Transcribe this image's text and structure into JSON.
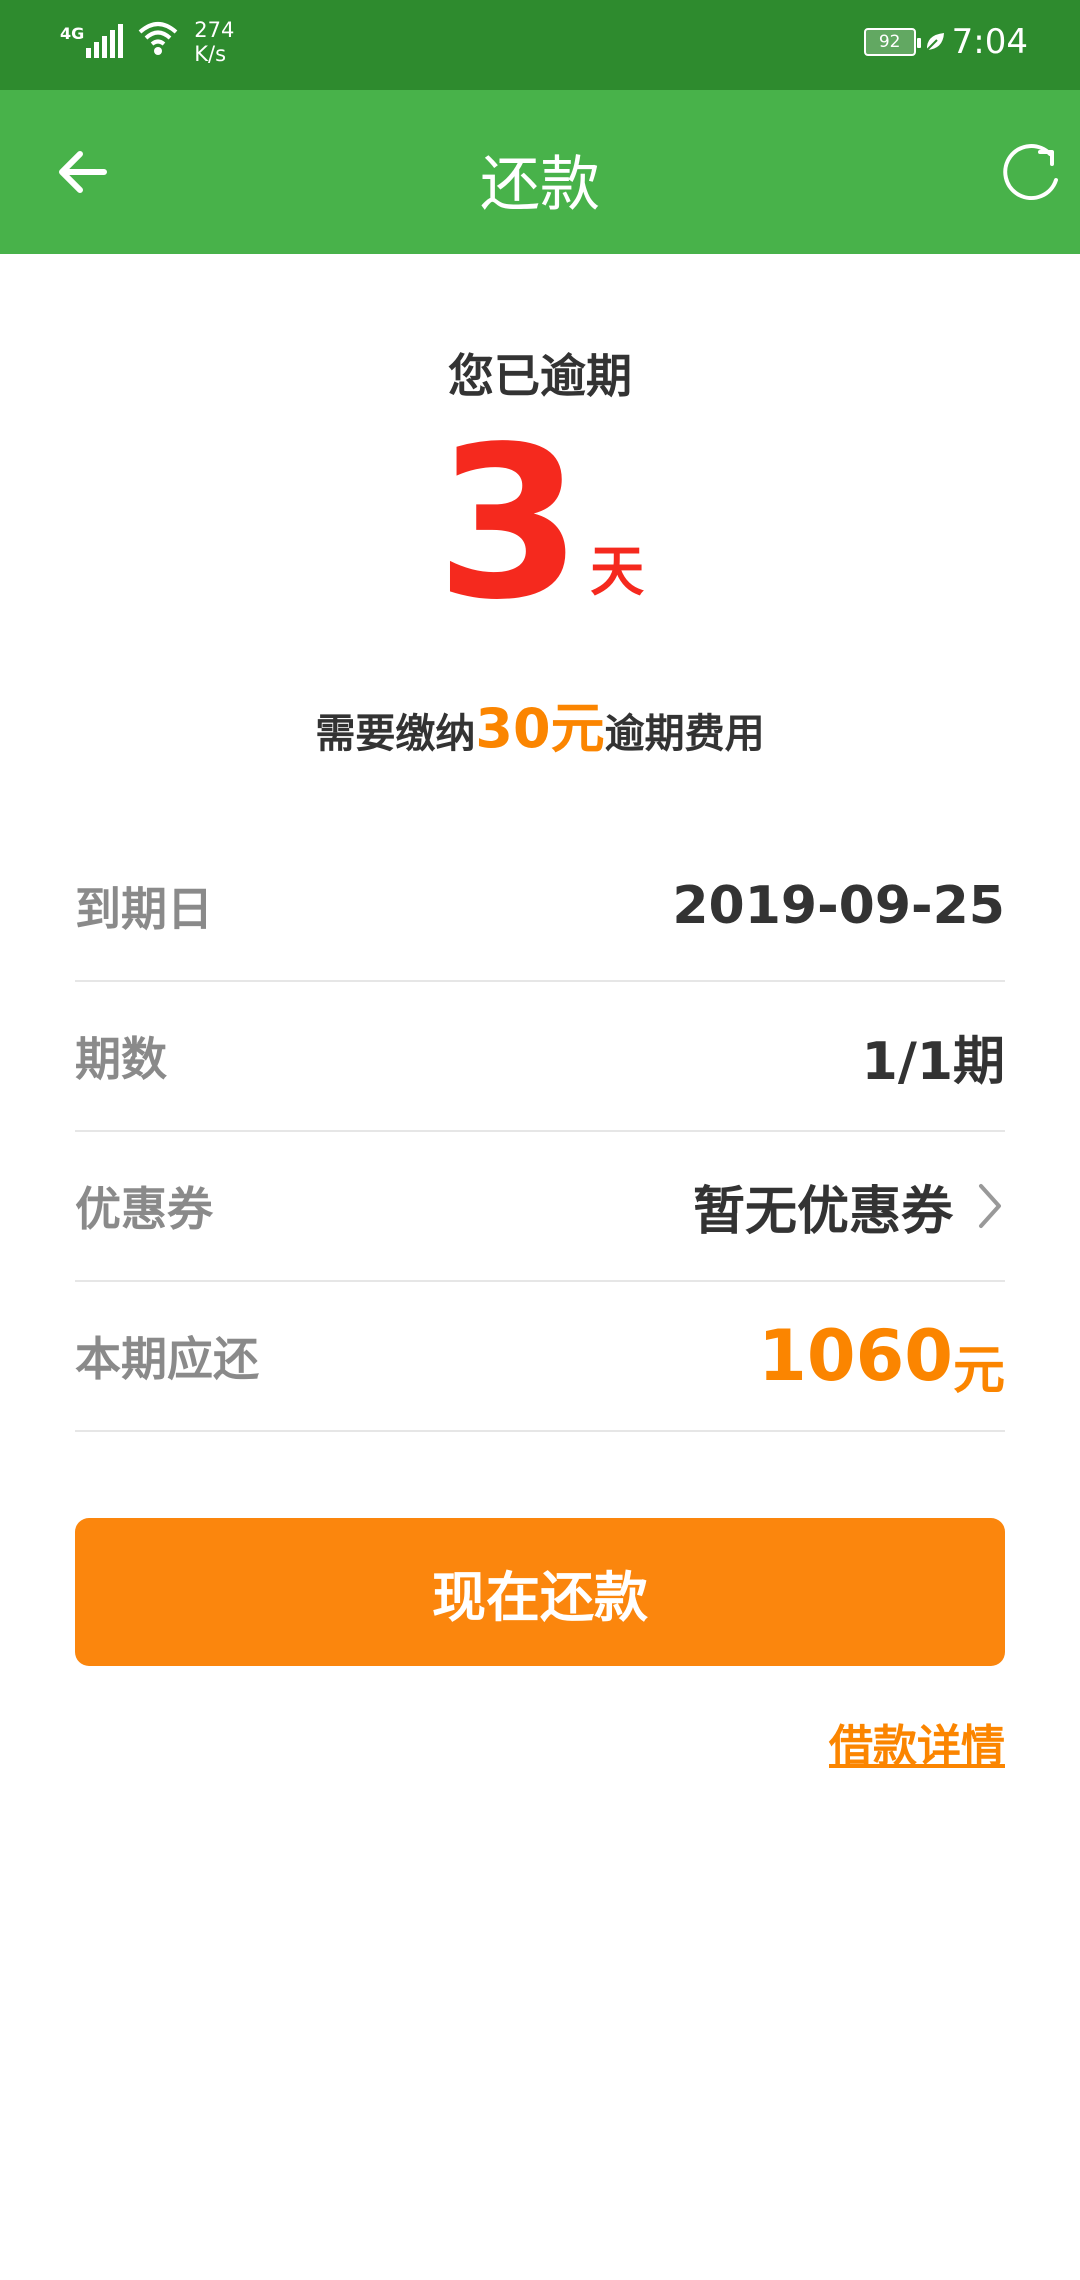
{
  "status_bar": {
    "network": "4G",
    "speed_value": "274",
    "speed_unit": "K/s",
    "battery": "92",
    "time": "7:04"
  },
  "app_bar": {
    "title": "还款"
  },
  "summary": {
    "overdue_title": "您已逾期",
    "days": "3",
    "days_unit": "天",
    "fee_prefix": "需要缴纳",
    "fee_amount": "30元",
    "fee_suffix": "逾期费用"
  },
  "rows": [
    {
      "label": "到期日",
      "value": "2019-09-25"
    },
    {
      "label": "期数",
      "value": "1/1期"
    },
    {
      "label": "优惠券",
      "value": "暂无优惠券"
    },
    {
      "label": "本期应还",
      "amount": "1060",
      "unit": "元"
    }
  ],
  "actions": {
    "pay_now": "现在还款",
    "loan_details": "借款详情"
  },
  "colors": {
    "status_bar": "#2e8b2e",
    "app_bar": "#48b24a",
    "overdue_red": "#f5291e",
    "accent_orange": "#fb8500"
  }
}
